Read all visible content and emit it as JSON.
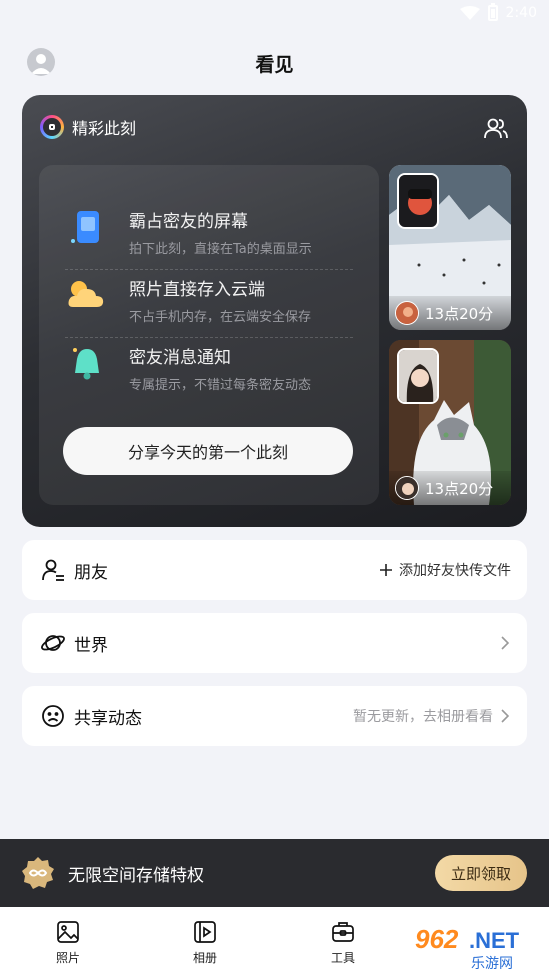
{
  "status": {
    "time": "2:40"
  },
  "header": {
    "title": "看见"
  },
  "hero": {
    "brand": "精彩此刻",
    "features": [
      {
        "title": "霸占密友的屏幕",
        "desc": "拍下此刻，直接在Ta的桌面显示",
        "icon": "phone-icon"
      },
      {
        "title": "照片直接存入云端",
        "desc": "不占手机内存，在云端安全保存",
        "icon": "cloud-icon"
      },
      {
        "title": "密友消息通知",
        "desc": "专属提示，不错过每条密友动态",
        "icon": "bell-icon"
      }
    ],
    "share_button": "分享今天的第一个此刻",
    "photos": [
      {
        "time": "13点20分",
        "scene": "snow-mountain"
      },
      {
        "time": "13点20分",
        "scene": "cat"
      }
    ]
  },
  "list": {
    "friends": {
      "title": "朋友",
      "action": "添加好友快传文件"
    },
    "world": {
      "title": "世界"
    },
    "shared": {
      "title": "共享动态",
      "hint": "暂无更新，去相册看看"
    }
  },
  "promo": {
    "text": "无限空间存储特权",
    "button": "立即领取"
  },
  "nav": {
    "photos": "照片",
    "album": "相册",
    "tools": "工具"
  },
  "watermark": {
    "brand": "962.NET",
    "sub": "乐游网"
  },
  "colors": {
    "background": "#f2f3f8",
    "hero_dark": "#2c2e33",
    "promo_dark": "#2a2b2f",
    "gold": "#e6c48a"
  }
}
